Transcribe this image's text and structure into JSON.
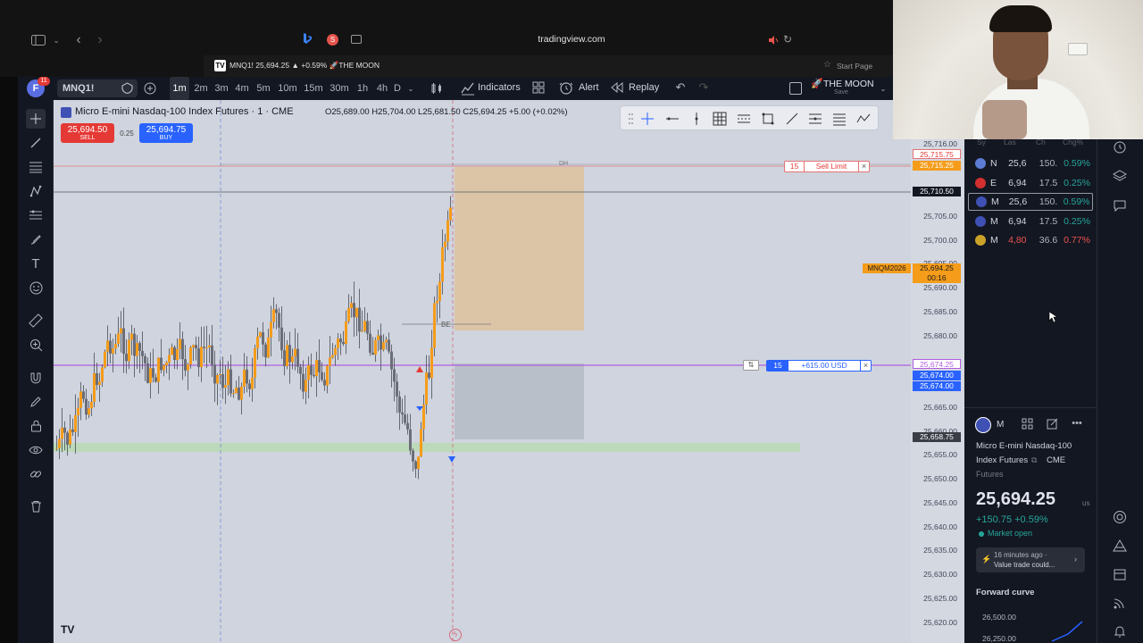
{
  "browser": {
    "url": "tradingview.com",
    "tab_title": "MNQ1! 25,694.25 ▲ +0.59% 🚀THE MOON",
    "start_page": "Start Page"
  },
  "toolbar": {
    "avatar_letter": "F",
    "avatar_badge": "11",
    "symbol": "MNQ1!",
    "timeframes": [
      "1m",
      "2m",
      "3m",
      "4m",
      "5m",
      "10m",
      "15m",
      "30m",
      "1h",
      "4h",
      "D"
    ],
    "active_timeframe": "1m",
    "indicators_label": "Indicators",
    "alert_label": "Alert",
    "replay_label": "Replay",
    "layout_name": "THE MOON",
    "layout_save": "Save"
  },
  "chart": {
    "title": "Micro E-mini Nasdaq-100 Index Futures · 1 · CME",
    "ohlc": "O25,689.00 H25,704.00 L25,681.50 C25,694.25 +5.00 (+0.02%)",
    "sell_price": "25,694.50",
    "sell_label": "SELL",
    "spread": "0.25",
    "buy_price": "25,694.75",
    "buy_label": "BUY",
    "dh_label": "DH",
    "be_label": "BE",
    "sell_limit_qty": "15",
    "sell_limit_label": "Sell Limit",
    "position_qty": "15",
    "position_pnl": "+615.00 USD",
    "close_x": "×",
    "symbol_tag": "MNQM2026",
    "tv_logo": "TV",
    "price_axis": [
      "25,716.00",
      "25,705.00",
      "25,700.00",
      "25,690.00",
      "25,685.00",
      "25,680.00",
      "25,665.00",
      "25,655.00",
      "25,650.00",
      "25,645.00",
      "25,640.00",
      "25,635.00",
      "25,630.00",
      "25,625.00",
      "25,620.00"
    ],
    "axis_labels": {
      "sell_limit_a": "25,715.75",
      "sell_limit_b": "25,715.25",
      "level_line": "25,710.50",
      "current_price": "25,694.25",
      "countdown": "00:16",
      "position_a": "25,674.25",
      "position_b": "25,674.00",
      "position_c": "25,674.00",
      "zone_level": "25,658.75",
      "hidden_a": "25,695.00",
      "hidden_b": "25,660.00"
    },
    "colors": {
      "bull": "#f59c1a",
      "bear": "#6b6e78",
      "sell": "#e53935",
      "buy": "#2962ff",
      "position_line": "#b05de0",
      "profit_zone": "#e8b87a",
      "stop_zone": "#a8adb8",
      "zone_green": "#b6d9b0"
    }
  },
  "watchlist": {
    "headers": [
      "Sy",
      "Las",
      "Ch",
      "Chg%"
    ],
    "rows": [
      {
        "sym": "N",
        "last": "25,6",
        "chg": "150.",
        "pct": "0.59%",
        "color": "#26a69a",
        "flag": "#5b7bd5"
      },
      {
        "sym": "E",
        "last": "6,94",
        "chg": "17.5",
        "pct": "0.25%",
        "color": "#26a69a",
        "flag": "#d32f2f"
      },
      {
        "sym": "M",
        "last": "25,6",
        "chg": "150.",
        "pct": "0.59%",
        "color": "#26a69a",
        "flag": "#3f51b5"
      },
      {
        "sym": "M",
        "last": "6,94",
        "chg": "17.5",
        "pct": "0.25%",
        "color": "#26a69a",
        "flag": "#3f51b5"
      },
      {
        "sym": "M",
        "last": "4,80",
        "chg": "36.6",
        "pct": "0.77%",
        "color": "#ef5350",
        "flag": "#c9a227"
      }
    ]
  },
  "details": {
    "symbol_short": "M",
    "name_line1": "Micro E-mini Nasdaq-100",
    "name_line2": "Index Futures",
    "exchange": "CME",
    "category": "Futures",
    "price_main": "25,694",
    "price_dec": ".25",
    "currency": "us",
    "change": "+150.75 +0.59%",
    "market_status": "Market open",
    "news_time": "16 minutes ago ·",
    "news_title": "Value trade could...",
    "forward_curve": "Forward curve",
    "fc_price_1": "26,500.00",
    "fc_price_2": "26,250.00"
  }
}
